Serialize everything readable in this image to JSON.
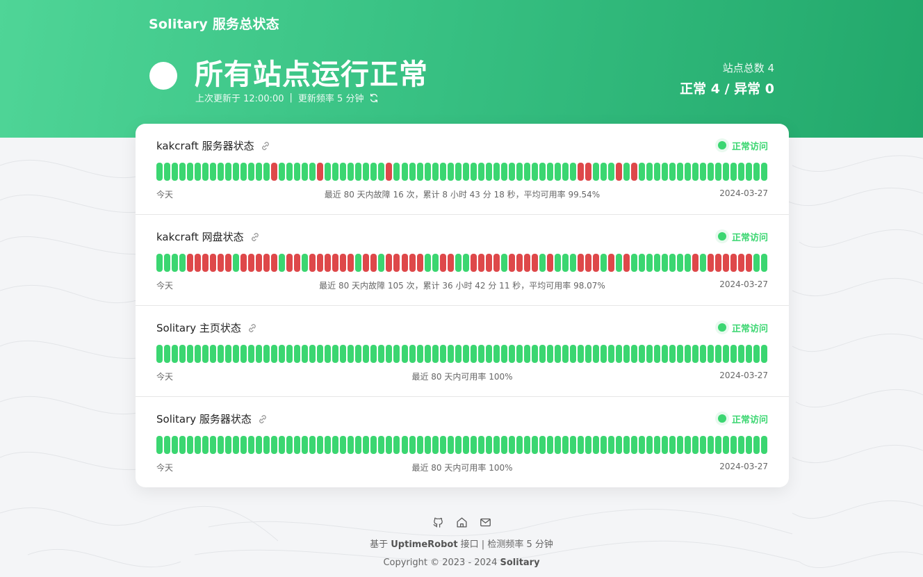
{
  "header": {
    "site_title": "Solitary 服务总状态",
    "headline": "所有站点运行正常",
    "last_update_label": "上次更新于 12:00:00",
    "separator": "|",
    "frequency_label": "更新频率 5 分钟",
    "site_total": "站点总数 4",
    "summary": "正常 4 / 异常 0",
    "accent_color": "#3bd671",
    "down_color": "#de484a"
  },
  "monitors": [
    {
      "name": "kakcraft 服务器状态",
      "status": "正常访问",
      "left_label": "今天",
      "summary": "最近 80 天内故障 16 次，累计 8 小时 43 分 18 秒，平均可用率 99.54%",
      "right_label": "2024-03-27",
      "down_days": [
        15,
        21,
        30,
        55,
        56,
        60,
        62
      ]
    },
    {
      "name": "kakcraft 网盘状态",
      "status": "正常访问",
      "left_label": "今天",
      "summary": "最近 80 天内故障 105 次，累计 36 小时 42 分 11 秒，平均可用率 98.07%",
      "right_label": "2024-03-27",
      "down_days": [
        4,
        5,
        6,
        7,
        8,
        9,
        11,
        12,
        13,
        14,
        15,
        17,
        18,
        20,
        21,
        22,
        23,
        24,
        25,
        27,
        28,
        30,
        31,
        32,
        33,
        34,
        37,
        38,
        41,
        42,
        43,
        44,
        46,
        47,
        48,
        49,
        51,
        55,
        56,
        57,
        59,
        61,
        70,
        72,
        73,
        74,
        75,
        76,
        77
      ]
    },
    {
      "name": "Solitary 主页状态",
      "status": "正常访问",
      "left_label": "今天",
      "summary": "最近 80 天内可用率 100%",
      "right_label": "2024-03-27",
      "down_days": []
    },
    {
      "name": "Solitary 服务器状态",
      "status": "正常访问",
      "left_label": "今天",
      "summary": "最近 80 天内可用率 100%",
      "right_label": "2024-03-27",
      "down_days": []
    }
  ],
  "footer": {
    "icons": [
      "github-icon",
      "home-icon",
      "mail-icon"
    ],
    "line1_prefix": "基于 ",
    "line1_brand": "UptimeRobot",
    "line1_suffix": " 接口 | 检测频率 5 分钟",
    "line2_prefix": "Copyright © 2023 - 2024 ",
    "line2_brand": "Solitary"
  }
}
